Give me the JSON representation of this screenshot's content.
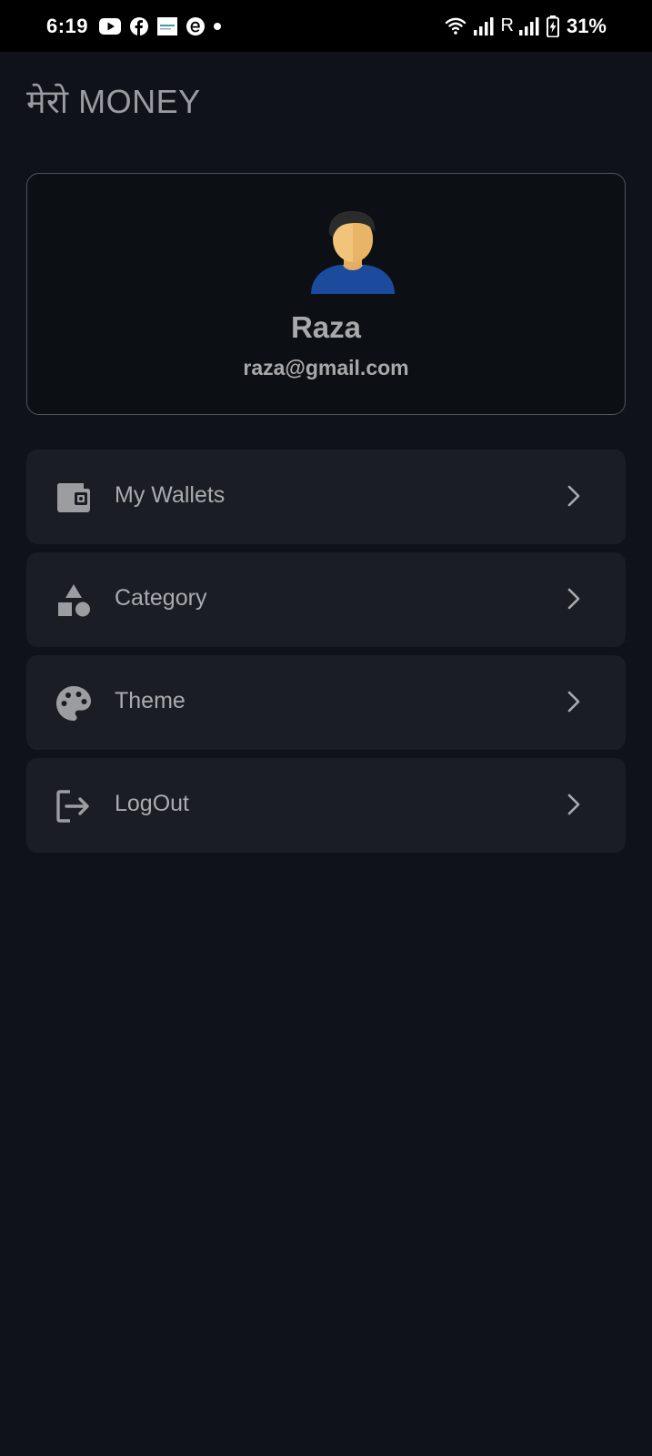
{
  "status_bar": {
    "time": "6:19",
    "roaming": "R",
    "battery_percent": "31%",
    "left_icons": [
      "youtube-icon",
      "facebook-icon",
      "news-icon",
      "e-icon",
      "notification-dot-icon"
    ],
    "right_icons": [
      "wifi-icon",
      "signal-icon",
      "signal-roaming-icon",
      "battery-charging-icon"
    ]
  },
  "app": {
    "title": "मेरो MONEY"
  },
  "profile": {
    "name": "Raza",
    "email": "raza@gmail.com",
    "avatar_icon": "user-avatar-icon"
  },
  "menu": {
    "items": [
      {
        "label": "My Wallets",
        "icon": "wallet-icon"
      },
      {
        "label": "Category",
        "icon": "shapes-icon"
      },
      {
        "label": "Theme",
        "icon": "palette-icon"
      },
      {
        "label": "LogOut",
        "icon": "logout-icon"
      }
    ]
  },
  "colors": {
    "background": "#0f1218",
    "card": "#1a1d23",
    "text": "#a9abae",
    "avatar_shirt": "#1c4a9c",
    "avatar_skin": "#f2c47a",
    "avatar_hair": "#2b2b2b"
  }
}
